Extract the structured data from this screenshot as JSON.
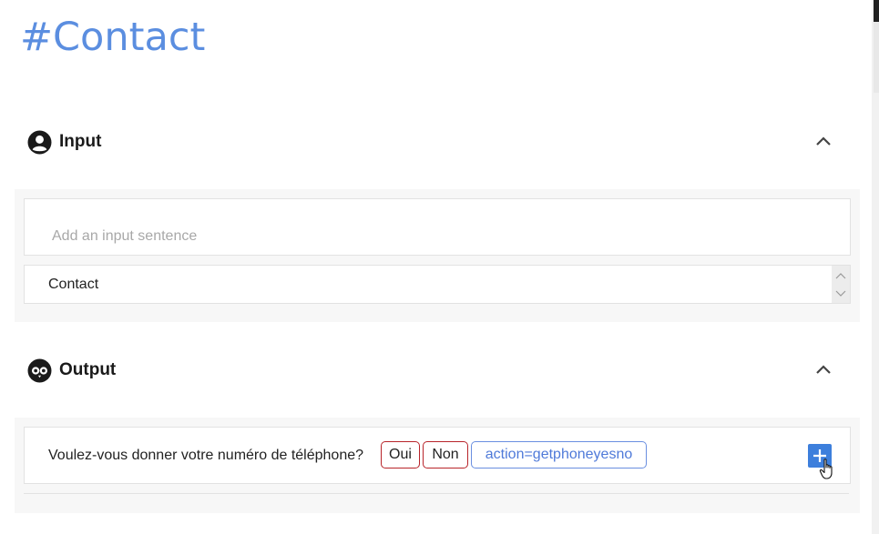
{
  "page": {
    "title": "#Contact"
  },
  "input_section": {
    "label": "Input",
    "icon": "account-circle-icon",
    "placeholder": "Add an input sentence",
    "value": "Contact"
  },
  "output_section": {
    "label": "Output",
    "icon": "owl-icon",
    "sentence": "Voulez-vous donner votre numéro de téléphone?",
    "tags": [
      {
        "label": "Oui",
        "color": "#b8242a"
      },
      {
        "label": "Non",
        "color": "#b8242a"
      },
      {
        "label": "action=getphoneyesno",
        "color": "#6a8fe0"
      }
    ]
  },
  "colors": {
    "accent": "#5b8ee0",
    "button": "#3d7fdc"
  }
}
